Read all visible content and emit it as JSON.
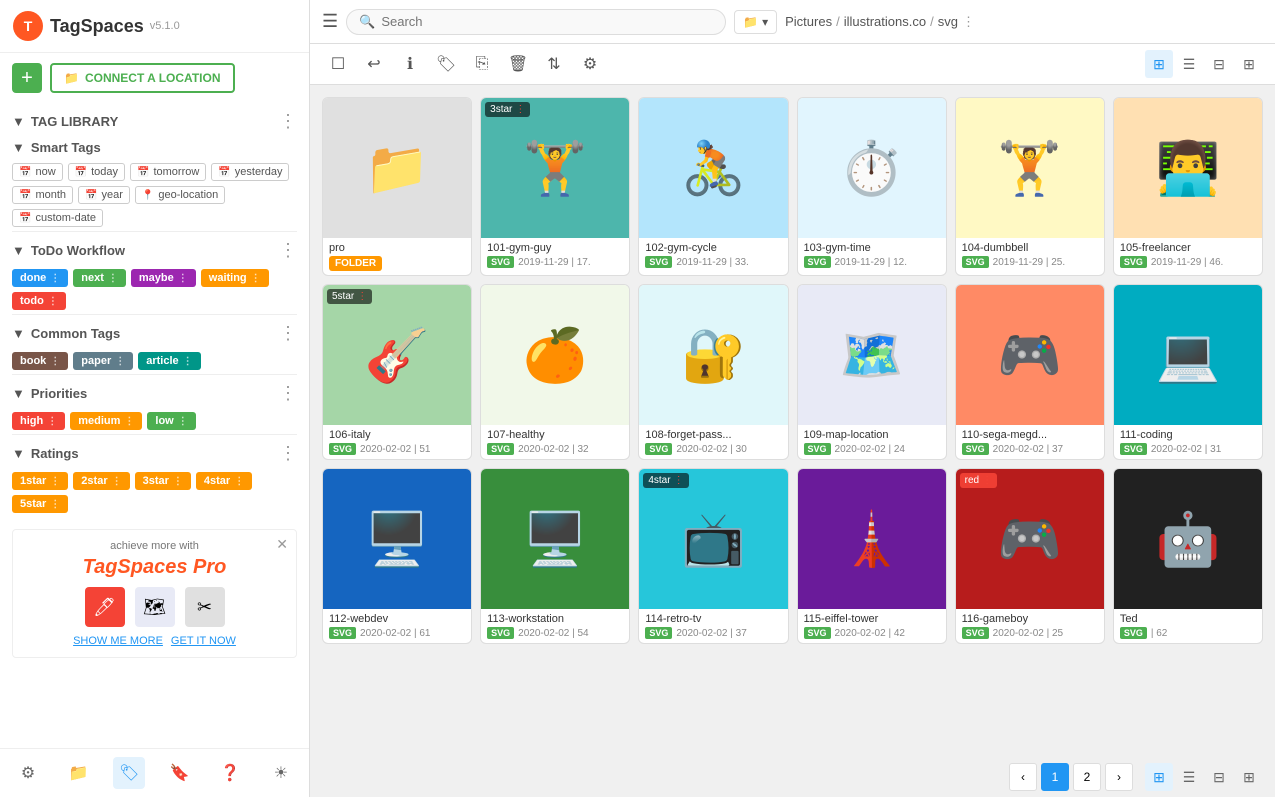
{
  "app": {
    "name": "TagSpaces",
    "version": "v5.1.0"
  },
  "sidebar": {
    "connect_label": "CONNECT A LOCATION",
    "tag_library_label": "TAG LIBRARY",
    "smart_tags": {
      "label": "Smart Tags",
      "tags": [
        {
          "id": "now",
          "label": "now",
          "icon": "cal"
        },
        {
          "id": "today",
          "label": "today",
          "icon": "cal"
        },
        {
          "id": "tomorrow",
          "label": "tomorrow",
          "icon": "cal"
        },
        {
          "id": "yesterday",
          "label": "yesterday",
          "icon": "cal"
        },
        {
          "id": "month",
          "label": "month",
          "icon": "cal"
        },
        {
          "id": "year",
          "label": "year",
          "icon": "cal"
        },
        {
          "id": "geo-location",
          "label": "geo-location",
          "icon": "geo"
        },
        {
          "id": "custom-date",
          "label": "custom-date",
          "icon": "cal"
        }
      ]
    },
    "todo_workflow": {
      "label": "ToDo Workflow",
      "tags": [
        {
          "id": "done",
          "label": "done",
          "color": "#2196f3"
        },
        {
          "id": "next",
          "label": "next",
          "color": "#4caf50"
        },
        {
          "id": "maybe",
          "label": "maybe",
          "color": "#9c27b0"
        },
        {
          "id": "waiting",
          "label": "waiting",
          "color": "#ff9800"
        },
        {
          "id": "todo",
          "label": "todo",
          "color": "#f44336"
        }
      ]
    },
    "common_tags": {
      "label": "Common Tags",
      "tags": [
        {
          "id": "book",
          "label": "book",
          "color": "#795548"
        },
        {
          "id": "paper",
          "label": "paper",
          "color": "#607d8b"
        },
        {
          "id": "article",
          "label": "article",
          "color": "#009688"
        }
      ]
    },
    "priorities": {
      "label": "Priorities",
      "tags": [
        {
          "id": "high",
          "label": "high",
          "color": "#f44336"
        },
        {
          "id": "medium",
          "label": "medium",
          "color": "#ff9800"
        },
        {
          "id": "low",
          "label": "low",
          "color": "#4caf50"
        }
      ]
    },
    "ratings": {
      "label": "Ratings",
      "tags": [
        {
          "id": "1star",
          "label": "1star",
          "color": "#ff9800"
        },
        {
          "id": "2star",
          "label": "2star",
          "color": "#ff9800"
        },
        {
          "id": "3star",
          "label": "3star",
          "color": "#ff9800"
        },
        {
          "id": "4star",
          "label": "4star",
          "color": "#ff9800"
        },
        {
          "id": "5star",
          "label": "5star",
          "color": "#ff9800"
        }
      ]
    },
    "promo": {
      "text": "achieve more with",
      "brand": "TagSpaces Pro",
      "show_me_more": "SHOW ME MORE",
      "get_it_now": "GET IT NOW"
    }
  },
  "topbar": {
    "search_placeholder": "Search",
    "breadcrumb": [
      "Pictures",
      "illustrations.co",
      "svg"
    ],
    "location_icon": "📁"
  },
  "grid": {
    "items": [
      {
        "id": "pro",
        "name": "pro",
        "type": "FOLDER",
        "bg": "#e8e8e8",
        "emoji": "📁",
        "date": "",
        "size": "",
        "star": null,
        "tag": null
      },
      {
        "id": "101-gym-guy",
        "name": "101-gym-guy",
        "type": "SVG",
        "bg": "#b2dfdb",
        "emoji": "🏋️",
        "date": "2019-11-29",
        "size": "17",
        "star": "3star",
        "tag": null
      },
      {
        "id": "102-gym-cycle",
        "name": "102-gym-cycle",
        "type": "SVG",
        "bg": "#b3e5fc",
        "emoji": "🚴",
        "date": "2019-11-29",
        "size": "33",
        "star": null,
        "tag": null
      },
      {
        "id": "103-gym-time",
        "name": "103-gym-time",
        "type": "SVG",
        "bg": "#e1f5fe",
        "emoji": "⏱️",
        "date": "2019-11-29",
        "size": "12",
        "star": null,
        "tag": null
      },
      {
        "id": "104-dumbbell",
        "name": "104-dumbbell",
        "type": "SVG",
        "bg": "#fff9c4",
        "emoji": "🏋️",
        "date": "2019-11-29",
        "size": "25",
        "star": null,
        "tag": null
      },
      {
        "id": "105-freelancer",
        "name": "105-freelancer",
        "type": "SVG",
        "bg": "#ffe0b2",
        "emoji": "💻",
        "date": "2019-11-29",
        "size": "46",
        "star": null,
        "tag": null
      },
      {
        "id": "106-italy",
        "name": "106-italy",
        "type": "SVG",
        "bg": "#a5d6a7",
        "emoji": "🎸",
        "date": "2020-02-02",
        "size": "51",
        "star": "5star",
        "tag": null
      },
      {
        "id": "107-healthy",
        "name": "107-healthy",
        "type": "SVG",
        "bg": "#e8f5e9",
        "emoji": "🍊",
        "date": "2020-02-02",
        "size": "32",
        "star": null,
        "tag": null
      },
      {
        "id": "108-forget-pass",
        "name": "108-forget-pass...",
        "type": "SVG",
        "bg": "#e0f7fa",
        "emoji": "🔐",
        "date": "2020-02-02",
        "size": "30",
        "star": null,
        "tag": null
      },
      {
        "id": "109-map-location",
        "name": "109-map-location",
        "type": "SVG",
        "bg": "#e8eaf6",
        "emoji": "🗺️",
        "date": "2020-02-02",
        "size": "24",
        "star": null,
        "tag": null
      },
      {
        "id": "110-sega-megdrive",
        "name": "110-sega-megdr...",
        "type": "SVG",
        "bg": "#ffccbc",
        "emoji": "🎮",
        "date": "2020-02-02",
        "size": "37",
        "star": null,
        "tag": null
      },
      {
        "id": "111-coding",
        "name": "111-coding",
        "type": "SVG",
        "bg": "#00acc1",
        "emoji": "💻",
        "date": "2020-02-02",
        "size": "31",
        "star": null,
        "tag": null
      },
      {
        "id": "112-webdev",
        "name": "112-webdev",
        "type": "SVG",
        "bg": "#1565c0",
        "emoji": "🖥️",
        "date": "2020-02-02",
        "size": "61",
        "star": null,
        "tag": null
      },
      {
        "id": "113-workstation",
        "name": "113-workstation",
        "type": "SVG",
        "bg": "#4caf50",
        "emoji": "🖥️",
        "date": "2020-02-02",
        "size": "54",
        "star": null,
        "tag": null
      },
      {
        "id": "114-retro-tv",
        "name": "114-retro-tv",
        "type": "SVG",
        "bg": "#26c6da",
        "emoji": "📺",
        "date": "2020-02-02",
        "size": "37",
        "star": "4star",
        "tag": null
      },
      {
        "id": "115-eiffel-tower",
        "name": "115-eiffel-tower",
        "type": "SVG",
        "bg": "#6a1b9a",
        "emoji": "🗼",
        "date": "2020-02-02",
        "size": "42",
        "star": null,
        "tag": null
      },
      {
        "id": "116-gameboy",
        "name": "116-gameboy",
        "type": "SVG",
        "bg": "#b71c1c",
        "emoji": "🎮",
        "date": "2020-02-02",
        "size": "25",
        "star": null,
        "tag": "red"
      },
      {
        "id": "ted",
        "name": "Ted",
        "type": "SVG",
        "bg": "#212121",
        "emoji": "🤖",
        "date": "",
        "size": "62",
        "star": null,
        "tag": null
      }
    ]
  },
  "pagination": {
    "current": 1,
    "pages": [
      "1",
      "2"
    ]
  },
  "toolbar": {
    "buttons": [
      "☐",
      "↩",
      "ℹ",
      "🏷",
      "⎘",
      "🗑",
      "⇅",
      "⚙"
    ]
  }
}
